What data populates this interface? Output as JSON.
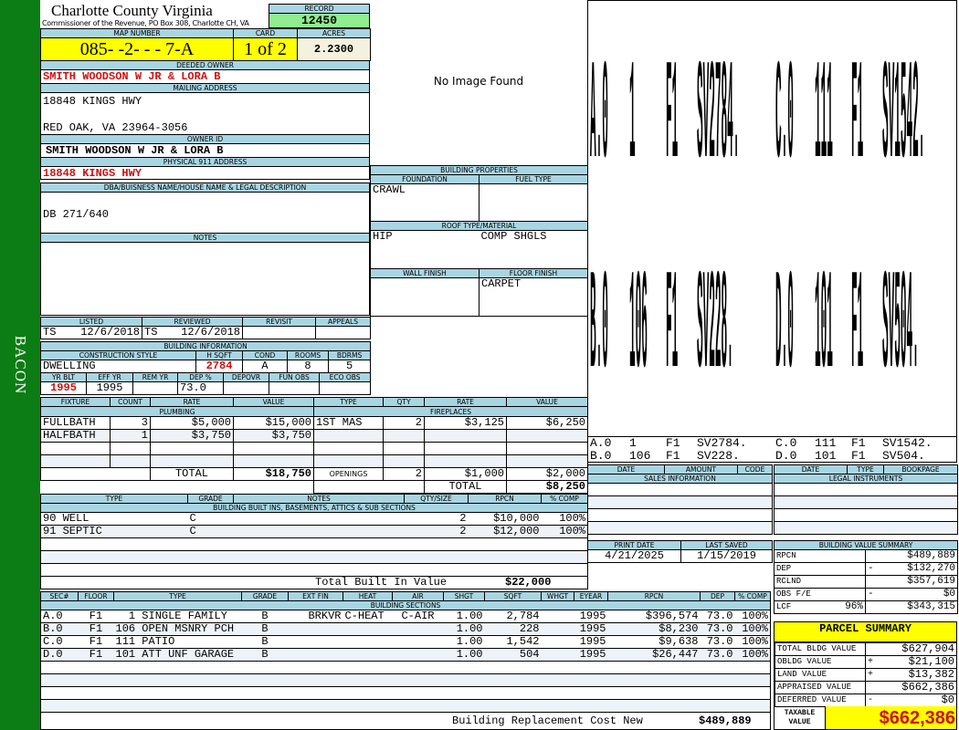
{
  "side_label": "BACON",
  "header": {
    "county": "Charlotte County Virginia",
    "subtitle": "Commissioner of the Revenue, PO Box 308, Charlotte CH, VA",
    "record_label": "RECORD",
    "record": "12450",
    "map_label": "MAP NUMBER",
    "map": "085- -2- - - 7-A",
    "card_label": "CARD",
    "card": "1 of 2",
    "acres_label": "ACRES",
    "acres": "2.2300"
  },
  "owner": {
    "deeded_label": "DEEDED OWNER",
    "deeded": "SMITH WOODSON W JR & LORA B",
    "mailing_label": "MAILING ADDRESS",
    "mailing_line1": "18848 KINGS HWY",
    "mailing_line2": "RED OAK, VA 23964-3056",
    "owner_id_label": "OWNER ID",
    "owner_id": "SMITH WOODSON W JR & LORA B",
    "physical_label": "PHYSICAL 911 ADDRESS",
    "physical": "18848 KINGS HWY"
  },
  "dba": {
    "label": "DBA/BUISNESS NAME/HOUSE NAME & LEGAL DESCRIPTION",
    "value": "DB 271/640"
  },
  "notes": {
    "label": "NOTES"
  },
  "image": {
    "text": "No Image Found"
  },
  "building_properties": {
    "title": "BUILDING PROPERTIES",
    "foundation_label": "FOUNDATION",
    "foundation": "CRAWL",
    "fuel_label": "FUEL TYPE",
    "fuel": "",
    "roof_label": "ROOF TYPE/MATERIAL",
    "roof_type": "HIP",
    "roof_material": "COMP SHGLS",
    "wall_label": "WALL FINISH",
    "wall": "",
    "floor_label": "FLOOR FINISH",
    "floor": "CARPET"
  },
  "listing": {
    "headers": [
      "LISTED",
      "REVIEWED",
      "REVISIT",
      "APPEALS"
    ],
    "listed_by": "TS",
    "listed_date": "12/6/2018",
    "reviewed_by": "TS",
    "reviewed_date": "12/6/2018",
    "revisit": "",
    "appeals": ""
  },
  "building_info": {
    "title": "BUILDING INFORMATION",
    "headers1": [
      "CONSTRUCTION STYLE",
      "H SQFT",
      "COND",
      "ROOMS",
      "BDRMS"
    ],
    "row1": {
      "style": "DWELLING",
      "hsqft": "2784",
      "cond": "A",
      "rooms": "8",
      "bdrms": "5"
    },
    "headers2": [
      "YR BLT",
      "EFF YR",
      "REM YR",
      "DEP %",
      "DEPOVR",
      "FUN OBS",
      "ECO OBS"
    ],
    "row2": {
      "yr_blt": "1995",
      "eff_yr": "1995",
      "rem_yr": "",
      "dep": "73.0",
      "depovr": "",
      "fun_obs": "",
      "eco_obs": ""
    }
  },
  "plumbing": {
    "title": "PLUMBING",
    "headers": [
      "FIXTURE",
      "COUNT",
      "RATE",
      "VALUE"
    ],
    "rows": [
      {
        "fixture": "FULLBATH",
        "count": "3",
        "rate": "$5,000",
        "value": "$15,000"
      },
      {
        "fixture": "HALFBATH",
        "count": "1",
        "rate": "$3,750",
        "value": "$3,750"
      }
    ],
    "total_label": "TOTAL",
    "total": "$18,750"
  },
  "fireplaces": {
    "title": "FIREPLACES",
    "headers": [
      "TYPE",
      "QTY",
      "RATE",
      "VALUE"
    ],
    "rows": [
      {
        "type": "1ST MAS",
        "qty": "2",
        "rate": "$3,125",
        "value": "$6,250"
      }
    ],
    "openings_label": "OPENINGS",
    "openings_qty": "2",
    "openings_rate": "$1,000",
    "openings_value": "$2,000",
    "total_label": "TOTAL",
    "total": "$8,250"
  },
  "builtins": {
    "title": "BUILDING BUILT INS, BASEMENTS, ATTICS & SUB SECTIONS",
    "headers": [
      "TYPE",
      "GRADE",
      "NOTES",
      "QTY/SIZE",
      "RPCN",
      "% COMP"
    ],
    "rows": [
      {
        "type": "90 WELL",
        "grade": "C",
        "notes": "",
        "qty": "2",
        "rpcn": "$10,000",
        "comp": "100%"
      },
      {
        "type": "91 SEPTIC",
        "grade": "C",
        "notes": "",
        "qty": "2",
        "rpcn": "$12,000",
        "comp": "100%"
      }
    ],
    "total_label": "Total Built In Value",
    "total": "$22,000"
  },
  "sections": {
    "title": "BUILDING SECTIONS",
    "headers": [
      "SEC#",
      "FLOOR",
      "TYPE",
      "GRADE",
      "EXT FIN",
      "HEAT",
      "AIR",
      "SHGT",
      "SQFT",
      "WHGT",
      "EYEAR",
      "RPCN",
      "DEP",
      "% COMP"
    ],
    "rows": [
      {
        "sec": "A.0",
        "floor": "F1",
        "type": "  1 SINGLE FAMILY",
        "grade": "B",
        "ext": "BRKVR",
        "heat": "C-HEAT",
        "air": "C-AIR",
        "shgt": "1.00",
        "sqft": "2,784",
        "whgt": "",
        "eyear": "1995",
        "rpcn": "$396,574",
        "dep": "73.0",
        "comp": "100%"
      },
      {
        "sec": "B.0",
        "floor": "F1",
        "type": "106 OPEN MSNRY PCH",
        "grade": "B",
        "ext": "",
        "heat": "",
        "air": "",
        "shgt": "1.00",
        "sqft": "228",
        "whgt": "",
        "eyear": "1995",
        "rpcn": "$8,230",
        "dep": "73.0",
        "comp": "100%"
      },
      {
        "sec": "C.0",
        "floor": "F1",
        "type": "111 PATIO",
        "grade": "B",
        "ext": "",
        "heat": "",
        "air": "",
        "shgt": "1.00",
        "sqft": "1,542",
        "whgt": "",
        "eyear": "1995",
        "rpcn": "$9,638",
        "dep": "73.0",
        "comp": "100%"
      },
      {
        "sec": "D.0",
        "floor": "F1",
        "type": "101 ATT UNF GARAGE",
        "grade": "B",
        "ext": "",
        "heat": "",
        "air": "",
        "shgt": "1.00",
        "sqft": "504",
        "whgt": "",
        "eyear": "1995",
        "rpcn": "$26,447",
        "dep": "73.0",
        "comp": "100%"
      }
    ],
    "total_label": "Building Replacement Cost New",
    "total": "$489,889"
  },
  "sketch": {
    "labels": [
      {
        "sec": "A.0",
        "code": "1",
        "floor": "F1",
        "sv": "SV2784."
      },
      {
        "sec": "B.0",
        "code": "106",
        "floor": "F1",
        "sv": "SV228."
      },
      {
        "sec": "C.0",
        "code": "111",
        "floor": "F1",
        "sv": "SV1542."
      },
      {
        "sec": "D.0",
        "code": "101",
        "floor": "F1",
        "sv": "SV504."
      }
    ]
  },
  "sales": {
    "title": "SALES INFORMATION",
    "headers": [
      "DATE",
      "AMOUNT",
      "CODE"
    ],
    "rows": []
  },
  "legal": {
    "title": "LEGAL INSTRUMENTS",
    "headers": [
      "DATE",
      "TYPE",
      "BOOKPAGE"
    ],
    "rows": []
  },
  "dates": {
    "print_label": "PRINT DATE",
    "print": "4/21/2025",
    "saved_label": "LAST SAVED",
    "saved": "1/15/2019"
  },
  "bvs": {
    "title": "BUILDING VALUE SUMMARY",
    "rows": [
      {
        "label": "RPCN",
        "pct": "",
        "sign": "",
        "value": "$489,889"
      },
      {
        "label": "DEP",
        "pct": "",
        "sign": "-",
        "value": "$132,270"
      },
      {
        "label": "RCLND",
        "pct": "",
        "sign": "",
        "value": "$357,619"
      },
      {
        "label": "OBS F/E",
        "pct": "",
        "sign": "-",
        "value": "$0"
      },
      {
        "label": "LCF",
        "pct": "96%",
        "sign": "",
        "value": "$343,315"
      }
    ]
  },
  "parcel": {
    "title": "PARCEL SUMMARY",
    "rows": [
      {
        "label": "TOTAL BLDG VALUE",
        "sign": "",
        "value": "$627,904"
      },
      {
        "label": "OBLDG VALUE",
        "sign": "+",
        "value": "$21,100"
      },
      {
        "label": "LAND VALUE",
        "sign": "+",
        "value": "$13,382"
      },
      {
        "label": "APPRAISED VALUE",
        "sign": "",
        "value": "$662,386"
      },
      {
        "label": "DEFERRED VALUE",
        "sign": "-",
        "value": "$0"
      }
    ],
    "taxable_label": "TAXABLE VALUE",
    "taxable": "$662,386"
  },
  "colors": {
    "side": "#0b7d14",
    "header": "#a9d5e3",
    "highlight": "#ffff00",
    "record": "#90ee90",
    "alert": "#d01010"
  }
}
